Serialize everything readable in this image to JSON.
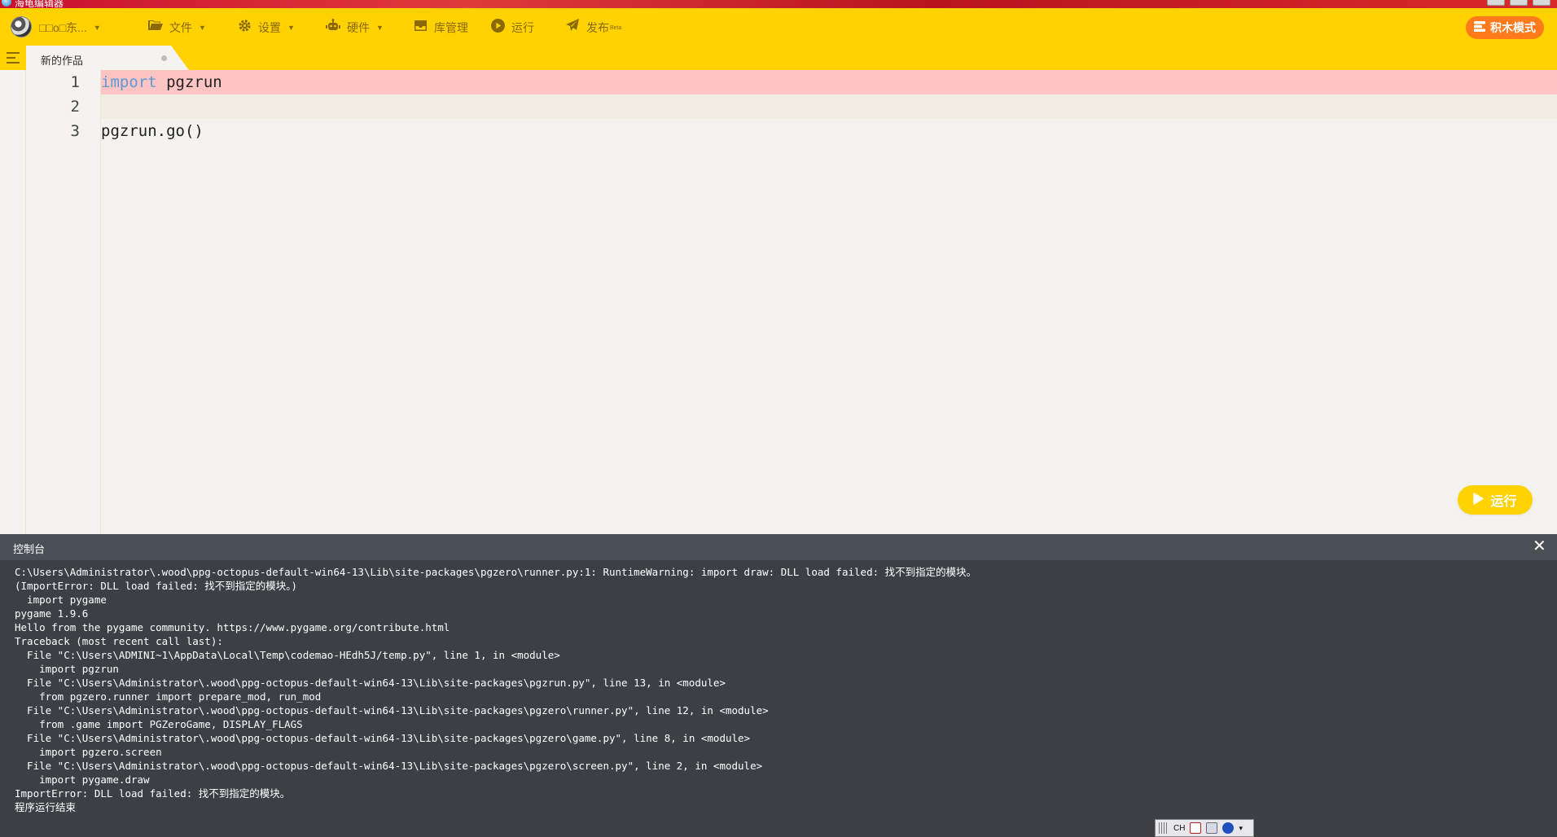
{
  "window": {
    "title": "海龟编辑器"
  },
  "toolbar": {
    "user_name": "□□o□东...",
    "file_label": "文件",
    "settings_label": "设置",
    "hardware_label": "硬件",
    "library_label": "库管理",
    "run_label": "运行",
    "publish_label": "发布",
    "publish_badge": "Beta",
    "blocks_mode_label": "积木模式",
    "accent_color": "#ffd200",
    "blocks_mode_color": "#ff7a1a"
  },
  "tabs": [
    {
      "label": "新的作品",
      "modified": true
    }
  ],
  "editor": {
    "lines": [
      {
        "number": "1",
        "keyword": "import",
        "rest": " pgzrun",
        "highlight": "error"
      },
      {
        "number": "2",
        "keyword": "",
        "rest": "",
        "highlight": "current"
      },
      {
        "number": "3",
        "keyword": "",
        "rest": "pgzrun.go()",
        "highlight": "none"
      }
    ],
    "run_button_label": "运行"
  },
  "console": {
    "title": "控制台",
    "output": "C:\\Users\\Administrator\\.wood\\ppg-octopus-default-win64-13\\Lib\\site-packages\\pgzero\\runner.py:1: RuntimeWarning: import draw: DLL load failed: 找不到指定的模块。\n(ImportError: DLL load failed: 找不到指定的模块。)\n  import pygame\npygame 1.9.6\nHello from the pygame community. https://www.pygame.org/contribute.html\nTraceback (most recent call last):\n  File \"C:\\Users\\ADMINI~1\\AppData\\Local\\Temp\\codemao-HEdh5J/temp.py\", line 1, in <module>\n    import pgzrun\n  File \"C:\\Users\\Administrator\\.wood\\ppg-octopus-default-win64-13\\Lib\\site-packages\\pgzrun.py\", line 13, in <module>\n    from pgzero.runner import prepare_mod, run_mod\n  File \"C:\\Users\\Administrator\\.wood\\ppg-octopus-default-win64-13\\Lib\\site-packages\\pgzero\\runner.py\", line 12, in <module>\n    from .game import PGZeroGame, DISPLAY_FLAGS\n  File \"C:\\Users\\Administrator\\.wood\\ppg-octopus-default-win64-13\\Lib\\site-packages\\pgzero\\game.py\", line 8, in <module>\n    import pgzero.screen\n  File \"C:\\Users\\Administrator\\.wood\\ppg-octopus-default-win64-13\\Lib\\site-packages\\pgzero\\screen.py\", line 2, in <module>\n    import pygame.draw\nImportError: DLL load failed: 找不到指定的模块。\n程序运行结束"
  },
  "tray": {
    "ime_label": "CH"
  }
}
